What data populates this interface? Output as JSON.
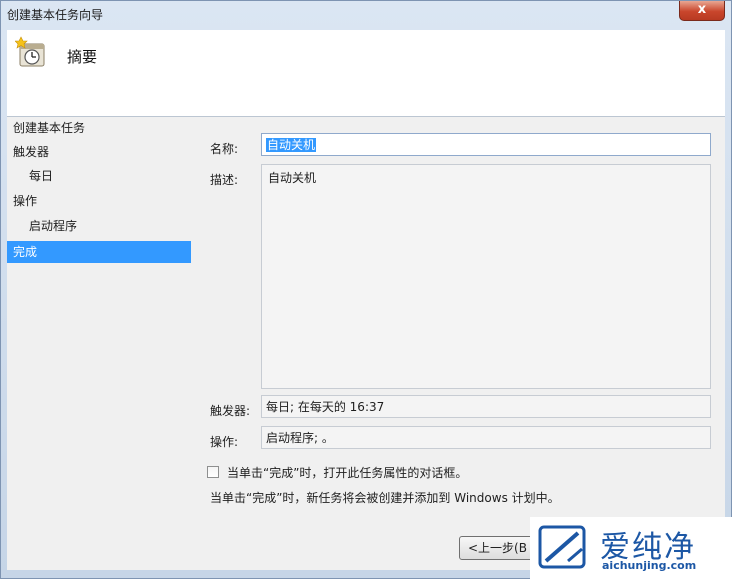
{
  "window": {
    "title": "创建基本任务向导",
    "close_label": "x"
  },
  "header": {
    "title": "摘要",
    "icon": "task-clock-icon"
  },
  "nav": {
    "items": [
      {
        "label": "创建基本任务",
        "indent": false,
        "selected": false
      },
      {
        "label": "触发器",
        "indent": false,
        "selected": false
      },
      {
        "label": "每日",
        "indent": true,
        "selected": false
      },
      {
        "label": "操作",
        "indent": false,
        "selected": false
      },
      {
        "label": "启动程序",
        "indent": true,
        "selected": false
      },
      {
        "label": "完成",
        "indent": false,
        "selected": true
      }
    ]
  },
  "form": {
    "name_label": "名称:",
    "name_value": "自动关机",
    "desc_label": "描述:",
    "desc_value": "自动关机",
    "trigger_label": "触发器:",
    "trigger_value": "每日; 在每天的 16:37",
    "action_label": "操作:",
    "action_value": "启动程序; 。",
    "open_props_checkbox_label": "当单击“完成”时，打开此任务属性的对话框。",
    "open_props_checked": false,
    "info_text": "当单击“完成”时，新任务将会被创建并添加到 Windows 计划中。"
  },
  "buttons": {
    "back_label": "<上一步(B"
  },
  "watermark": {
    "cn": "爱纯净",
    "en": "aichunjing.com"
  }
}
